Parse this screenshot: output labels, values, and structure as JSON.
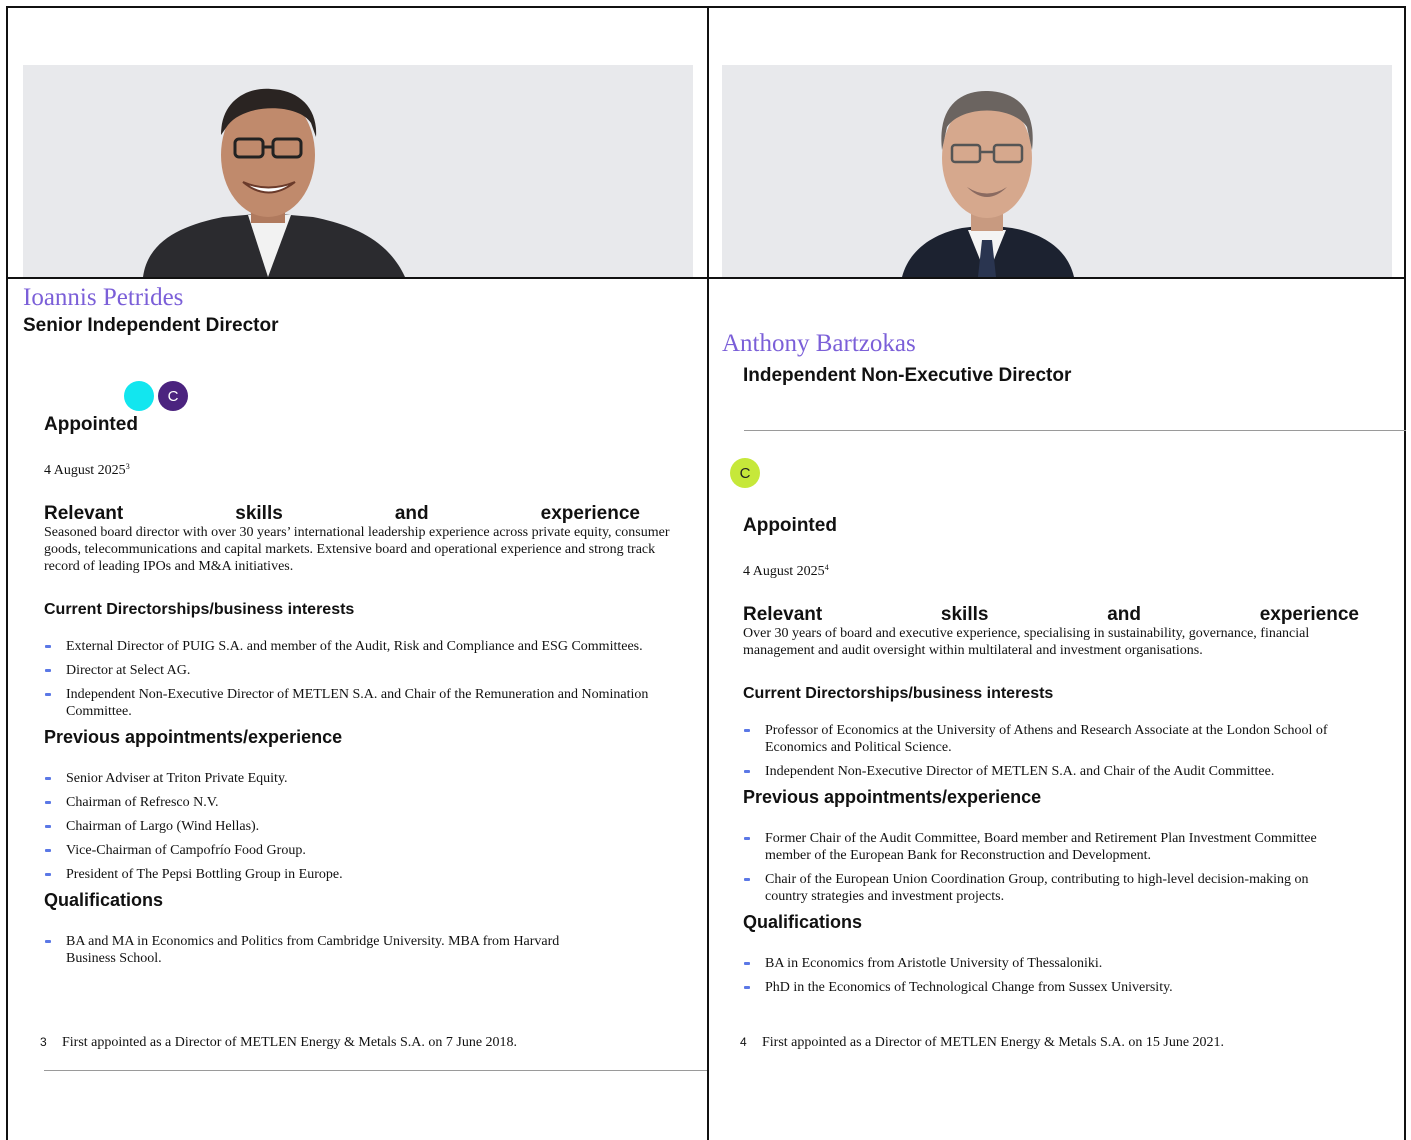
{
  "left": {
    "name": "Ioannis Petrides",
    "role": "Senior Independent Director",
    "badges": [
      {
        "label": "",
        "color": "#12e6ef"
      },
      {
        "label": "C",
        "color": "#4b237f"
      }
    ],
    "appointed_heading": "Appointed",
    "appointed_date": "4 August 2025",
    "appointed_note": "3",
    "skills_heading_words": [
      "Relevant",
      "skills",
      "and",
      "experience"
    ],
    "skills_text": "Seasoned board director with over 30 years’ international leadership experience across  private equity, consumer goods, telecommunications and capital markets. Extensive board   and operational experience and strong track record of leading IPOs and M&A initiatives.",
    "current_heading": "Current Directorships/business interests",
    "current_items": [
      "External Director of PUIG S.A. and member of the Audit, Risk and Compliance and ESG Committees.",
      "Director at Select AG.",
      "Independent Non-Executive Director of METLEN S.A. and Chair of the Remuneration and Nomination Committee."
    ],
    "previous_heading": "Previous appointments/experience",
    "previous_items": [
      "Senior Adviser at Triton Private Equity.",
      "Chairman of Refresco N.V.",
      "Chairman of Largo (Wind Hellas).",
      "Vice-Chairman of Campofrío Food Group.",
      "President of The Pepsi Bottling Group in Europe."
    ],
    "qualifications_heading": "Qualifications",
    "qualifications_items": [
      "BA and MA in Economics and Politics from Cambridge University. MBA from Harvard Business School."
    ],
    "footnote_num": "3",
    "footnote_text": "First appointed as a Director of METLEN Energy & Metals S.A. on 7 June 2018."
  },
  "right": {
    "name": "Anthony Bartzokas",
    "role": "Independent Non-Executive Director",
    "badges": [
      {
        "label": "C",
        "color": "#c6e83a"
      }
    ],
    "appointed_heading": "Appointed",
    "appointed_date": "4 August 2025",
    "appointed_note": "4",
    "skills_heading_words": [
      "Relevant",
      "skills",
      "and",
      "experience"
    ],
    "skills_text": "Over 30 years of board and executive experience, specialising in sustainability, governance, financial management and audit oversight within multilateral and investment organisations.",
    "current_heading": "Current Directorships/business interests",
    "current_items": [
      "Professor of Economics at the University of Athens and Research Associate at the London School of Economics and Political Science.",
      "Independent Non-Executive Director of METLEN S.A. and Chair of the Audit Committee."
    ],
    "previous_heading": "Previous appointments/experience",
    "previous_items": [
      "Former Chair of the Audit Committee, Board member and Retirement Plan Investment Committee member of the European Bank for Reconstruction and Development.",
      "Chair of the European Union Coordination Group, contributing to high-level decision-making on country strategies and investment projects."
    ],
    "qualifications_heading": "Qualifications",
    "qualifications_items": [
      "BA in Economics from Aristotle University of Thessaloniki.",
      "PhD in the Economics of Technological Change from Sussex University."
    ],
    "footnote_num": "4",
    "footnote_text": "First appointed as a Director of METLEN Energy & Metals S.A. on 15 June 2021."
  }
}
